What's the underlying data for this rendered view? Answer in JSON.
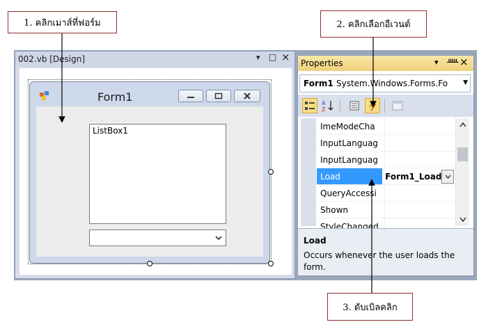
{
  "callouts": {
    "step1": "1. คลิกเมาส์ที่ฟอร์ม",
    "step2": "2. คลิกเลือกอีเวนต์",
    "step3": "3. ดับเบิลคลิก"
  },
  "designer": {
    "tab_title": "002.vb [Design]",
    "form_title": "Form1",
    "listbox_text": "ListBox1"
  },
  "properties": {
    "title": "Properties",
    "object_name": "Form1",
    "object_type": "System.Windows.Forms.Fo",
    "rows": [
      {
        "name": "ImeModeCha",
        "value": ""
      },
      {
        "name": "InputLanguag",
        "value": ""
      },
      {
        "name": "InputLanguag",
        "value": ""
      },
      {
        "name": "Load",
        "value": "Form1_Load"
      },
      {
        "name": "QueryAccessi",
        "value": ""
      },
      {
        "name": "Shown",
        "value": ""
      },
      {
        "name": "StyleChanged",
        "value": ""
      }
    ],
    "description_title": "Load",
    "description_text": "Occurs whenever the user loads the form.",
    "selected_row": "Load"
  },
  "colors": {
    "selection": "#3399ff",
    "callout_border": "#8b2e2a",
    "title_gradient": "#f0d07a"
  }
}
